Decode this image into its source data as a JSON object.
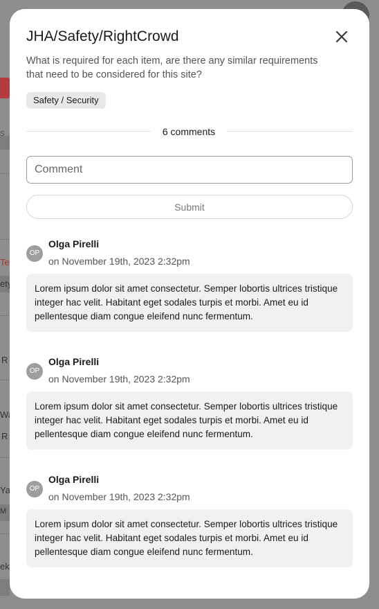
{
  "background": {
    "fragments": [
      "s",
      "Te",
      "ety",
      "R",
      "Wa",
      "R",
      "Ya",
      "M",
      "ek"
    ]
  },
  "modal": {
    "title": "JHA/Safety/RightCrowd",
    "description": "What is required for each item, are there any similar requirements that need to be considered for this site?",
    "tag": "Safety / Security",
    "comments_count": "6 comments",
    "comment_placeholder": "Comment",
    "submit_label": "Submit",
    "close_icon": "close-icon"
  },
  "comments": [
    {
      "initials": "OP",
      "author": "Olga Pirelli",
      "timestamp": "on November 19th, 2023 2:32pm",
      "text": "Lorem ipsum dolor sit amet consectetur. Semper lobortis ultrices tristique integer hac velit. Habitant eget sodales turpis et morbi. Amet eu id pellentesque diam congue eleifend nunc fermentum."
    },
    {
      "initials": "OP",
      "author": "Olga Pirelli",
      "timestamp": "on November 19th, 2023 2:32pm",
      "text": "Lorem ipsum dolor sit amet consectetur. Semper lobortis ultrices tristique integer hac velit. Habitant eget sodales turpis et morbi. Amet eu id pellentesque diam congue eleifend nunc fermentum."
    },
    {
      "initials": "OP",
      "author": "Olga Pirelli",
      "timestamp": "on November 19th, 2023 2:32pm",
      "text": "Lorem ipsum dolor sit amet consectetur. Semper lobortis ultrices tristique integer hac velit. Habitant eget sodales turpis et morbi. Amet eu id pellentesque diam congue eleifend nunc fermentum."
    }
  ],
  "colors": {
    "overlay": "#8f8f8f",
    "accent_red": "#b53c3c",
    "comment_bg": "#f1f1f1",
    "avatar_bg": "#9e9e9e"
  }
}
